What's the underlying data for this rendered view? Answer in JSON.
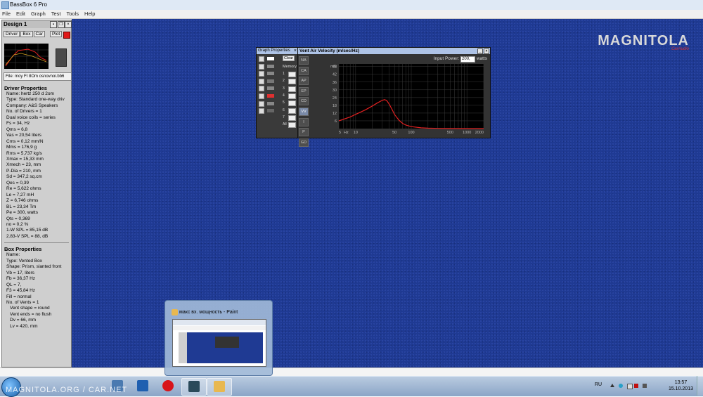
{
  "window": {
    "title": "BassBox 6 Pro"
  },
  "menu": [
    "File",
    "Edit",
    "Graph",
    "Test",
    "Tools",
    "Help"
  ],
  "design_panel": {
    "title": "Design 1",
    "tabs": [
      "Driver",
      "Box",
      "Car"
    ],
    "plot_label": "Plot",
    "file": "File: moy FI 8Om osnovnoi.bb6",
    "driver_header": "Driver Properties",
    "driver_lines": [
      "Name: hertz 250 d 2om",
      "Type: Standard one-way driv",
      "Company: A&S Speakers",
      "No. of Drivers = 1",
      "Dual voice coils = series",
      "Fs = 34, Hz",
      "Qms = 6,8",
      "Vas = 20,54 liters",
      "Cms = 0,12 mm/N",
      "Mms = 176,9 g",
      "Rms = 5,737 kg/s",
      "Xmax = 15,33 mm",
      "Xmech = 23, mm",
      "P-Dia = 210, mm",
      "Sd = 347,2 sq.cm",
      "Qes = 0,39",
      "Re = 5,622 ohms",
      "Le = 7,27 mH",
      "Z = 6,746 ohms",
      "BL = 23,34 Tm",
      "Pe = 300, watts",
      "Qts = 0,369",
      "no = 0,2 %",
      "1-W SPL = 85,15 dB",
      "2.83-V SPL = 88, dB"
    ],
    "box_header": "Box Properties",
    "box_lines": [
      "Name:",
      "Type: Vented Box",
      "Shape: Prism, slanted front",
      "Vb = 17, liters",
      "Fb = 36,37 Hz",
      "QL = 7,",
      "F3 = 45,84 Hz",
      "Fill = normal",
      "No. of Vents = 1"
    ],
    "box_indented": [
      "Vent shape = round",
      "Vent ends = no flush",
      "Dv = 66, mm",
      "Lv = 420, mm"
    ]
  },
  "graph_props": {
    "title": "Graph Properties",
    "clear_label": "Clear",
    "memory_label": "Memory",
    "memory_numbers": [
      "1",
      "2",
      "3",
      "4",
      "5",
      "6",
      "7",
      "All"
    ]
  },
  "vent_window": {
    "title": "Vent Air Velocity (m/sec/Hz)",
    "side_buttons": [
      "NA",
      "CA",
      "AP",
      "EP",
      "CD",
      "VV",
      "I",
      "P",
      "GD"
    ],
    "input_power_label": "Input Power:",
    "input_power_value": "200,",
    "input_power_unit": "watts"
  },
  "chart_data": {
    "type": "line",
    "ylabel": "m/s",
    "xlabel": "Hz",
    "x_ticks": [
      "5",
      "10",
      "50",
      "100",
      "500",
      "1000",
      "2000"
    ],
    "y_ticks": [
      "48",
      "42",
      "36",
      "30",
      "24",
      "18",
      "12",
      "6"
    ],
    "xlim": [
      5,
      2000
    ],
    "ylim": [
      0,
      50
    ],
    "x_scale": "log",
    "grid": true,
    "series": [
      {
        "color": "#e02020",
        "x": [
          5,
          8,
          10,
          15,
          20,
          25,
          30,
          33,
          36,
          40,
          45,
          50,
          60,
          70,
          80,
          100,
          150,
          200,
          300,
          500,
          1000,
          2000
        ],
        "y": [
          6,
          9,
          11,
          14.5,
          17.5,
          20,
          21.8,
          22.4,
          21.8,
          19,
          15,
          11,
          6.5,
          4,
          2.7,
          1.5,
          0.6,
          0.3,
          0.15,
          0.05,
          0,
          0
        ]
      }
    ],
    "line_color": "#e02020"
  },
  "taskbar": {
    "watermark": "MAGNITOLA.ORG / CAR.NET",
    "lang": "RU",
    "time": "13:57",
    "date": "15.10.2013"
  },
  "preview": {
    "title": "макс вх. мощность - Paint"
  },
  "logo": {
    "text": "MAGNITOLA",
    "sub": "CarAudio"
  }
}
